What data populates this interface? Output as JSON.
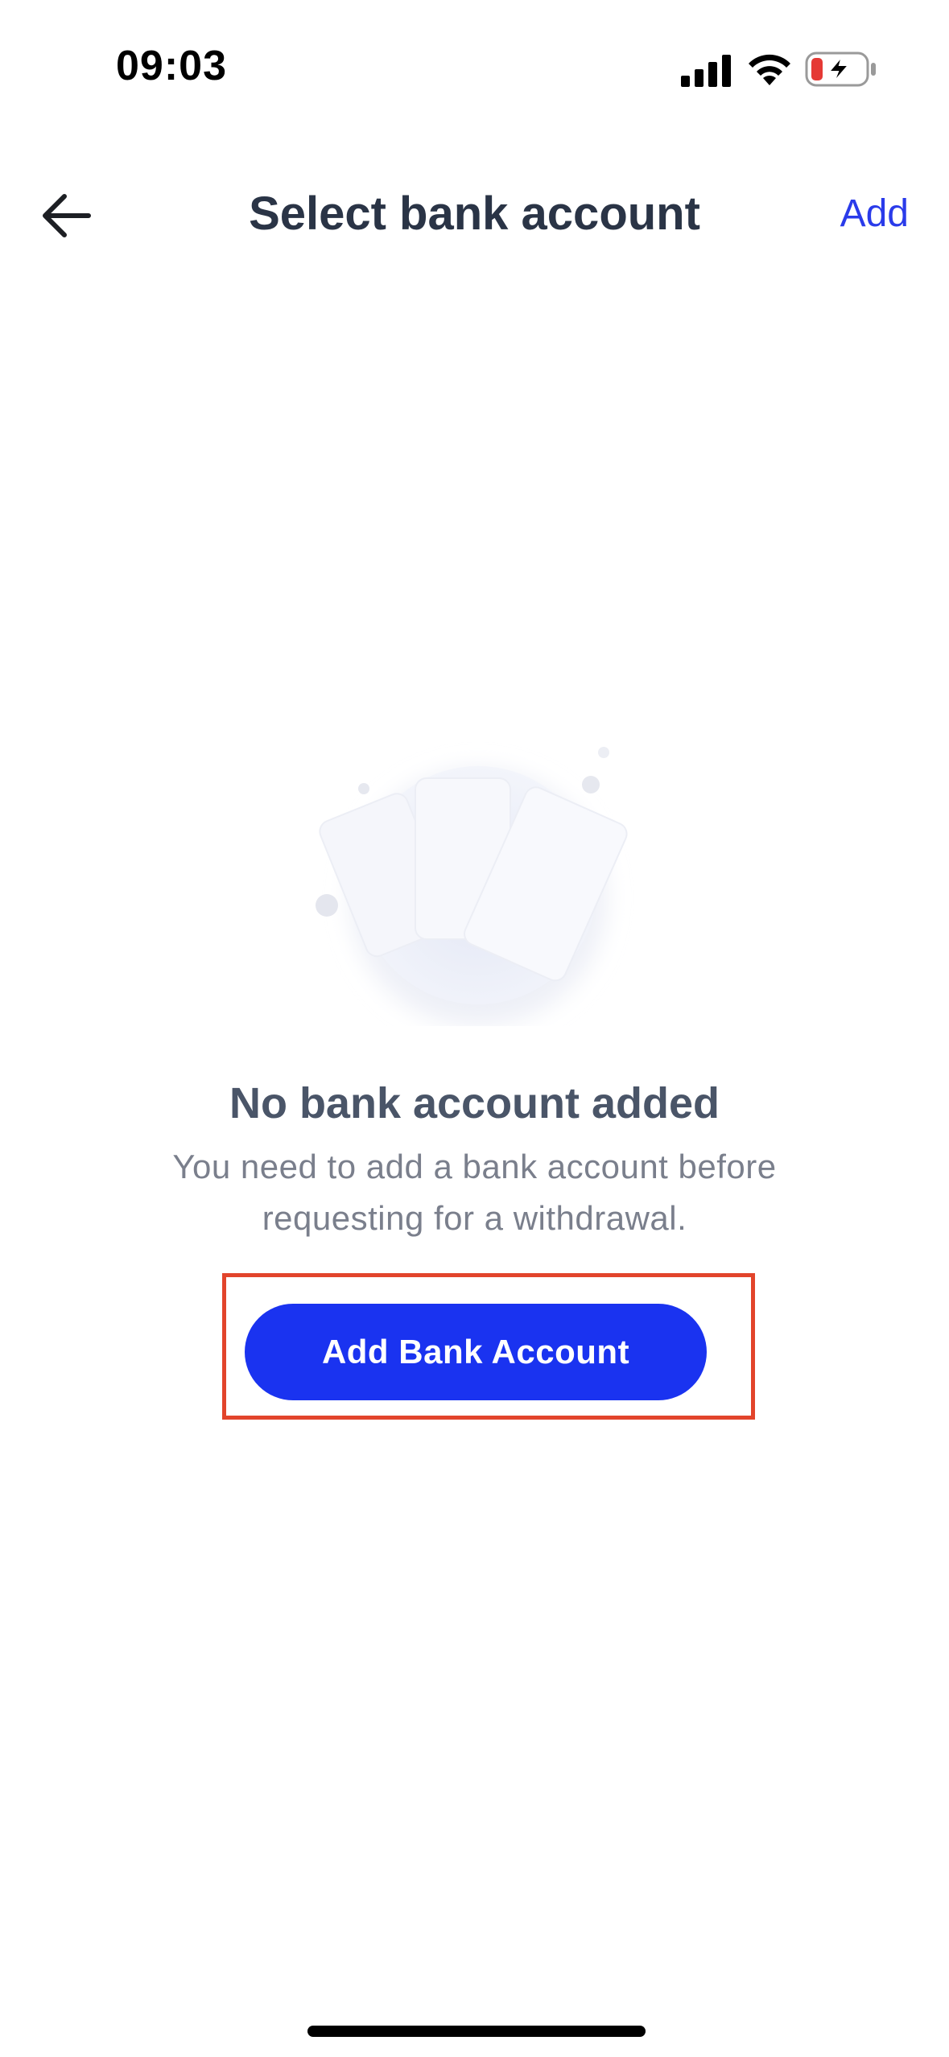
{
  "status_bar": {
    "time": "09:03",
    "signal_icon": "cellular-signal-icon",
    "wifi_icon": "wifi-icon",
    "battery_icon": "battery-charging-icon"
  },
  "nav": {
    "back_icon": "arrow-left-icon",
    "title": "Select bank account",
    "add_label": "Add"
  },
  "empty_state": {
    "illustration": "cards-illustration",
    "title": "No bank account added",
    "description": "You need to add a bank account before requesting for a withdrawal."
  },
  "actions": {
    "add_bank_account_label": "Add Bank Account"
  },
  "colors": {
    "accent": "#1a33f0",
    "link": "#2a3bea",
    "highlight": "#e2442b",
    "title": "#2a3446",
    "muted": "#7a7f8c"
  }
}
